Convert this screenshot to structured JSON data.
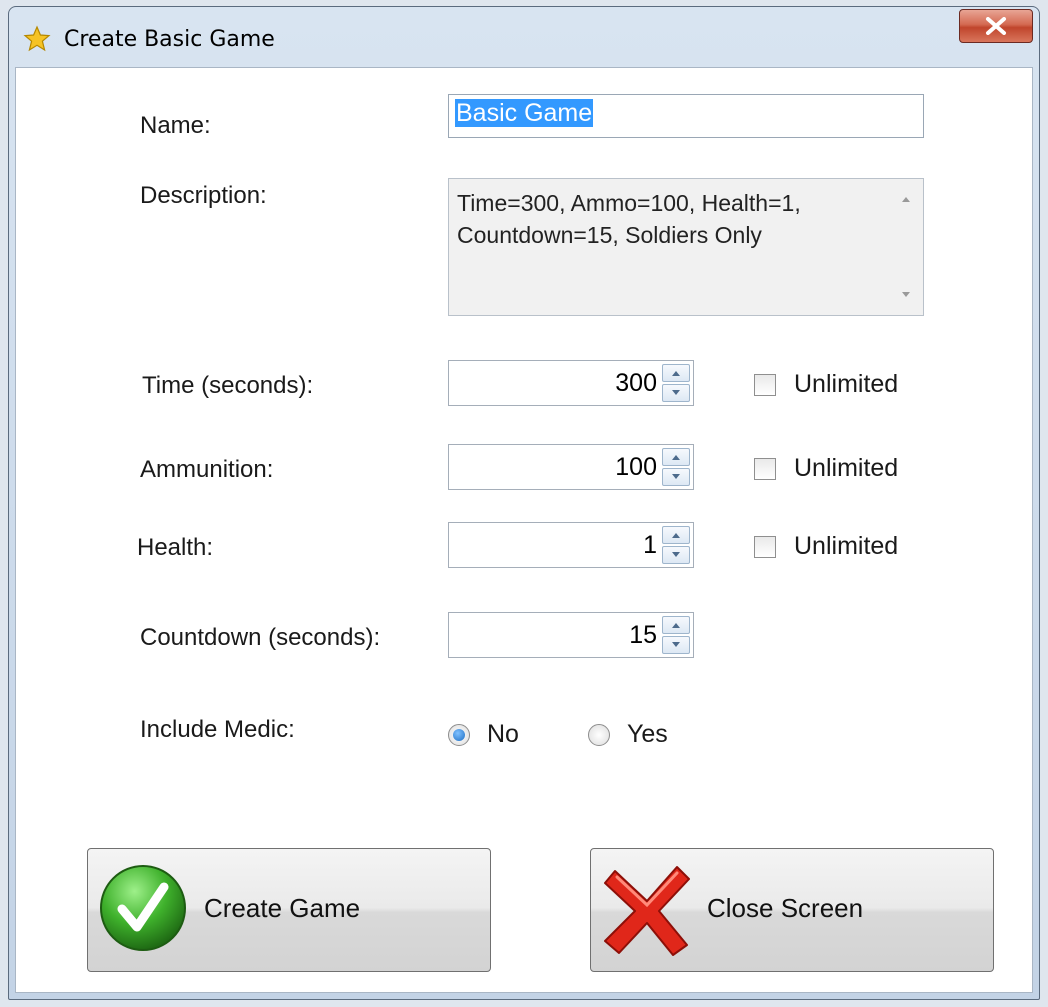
{
  "window": {
    "title": "Create Basic Game"
  },
  "form": {
    "name_label": "Name:",
    "name_value": "Basic Game",
    "description_label": "Description:",
    "description_value": "Time=300, Ammo=100, Health=1, Countdown=15, Soldiers Only",
    "time_label": "Time (seconds):",
    "time_value": "300",
    "ammunition_label": "Ammunition:",
    "ammunition_value": "100",
    "health_label": "Health:",
    "health_value": "1",
    "countdown_label": "Countdown (seconds):",
    "countdown_value": "15",
    "unlimited_label": "Unlimited",
    "medic_label": "Include Medic:",
    "medic_options": [
      "No",
      "Yes"
    ],
    "medic_selected": "No"
  },
  "buttons": {
    "create_label": "Create Game",
    "close_label": "Close Screen"
  }
}
